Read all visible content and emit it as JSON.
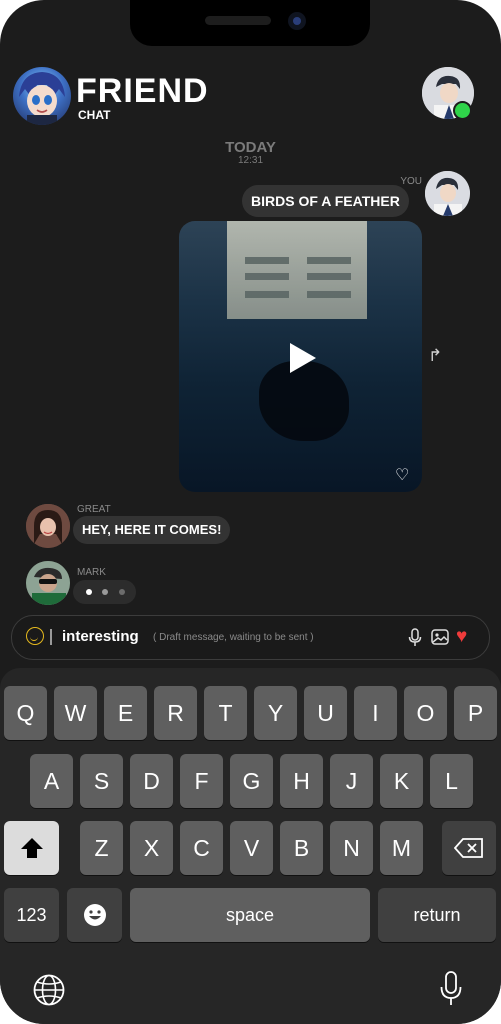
{
  "header": {
    "title": "FRIEND",
    "subtitle": "CHAT",
    "status_color": "#2fd44a"
  },
  "conversation": {
    "date_label": "TODAY",
    "time": "12:31",
    "messages": [
      {
        "sender": "YOU",
        "text": "BIRDS OF A FEATHER",
        "type": "text"
      },
      {
        "sender": "YOU",
        "type": "video",
        "icons": [
          "play-icon",
          "heart-icon",
          "share-icon"
        ]
      },
      {
        "sender": "GREAT",
        "text": "HEY, HERE IT COMES!",
        "type": "text"
      },
      {
        "sender": "MARK",
        "type": "typing",
        "dot_colors": [
          "#ffffff",
          "#9a9a9a",
          "#6c6c6c"
        ]
      }
    ]
  },
  "composer": {
    "draft_text": "interesting",
    "draft_hint": "( Draft message, waiting to be sent )",
    "icons": [
      "emoji-icon",
      "microphone-icon",
      "image-icon",
      "heart-icon"
    ],
    "heart_color": "#ef3b3b",
    "emoji_color": "#e5b91e"
  },
  "keyboard": {
    "row1": [
      "Q",
      "W",
      "E",
      "R",
      "T",
      "Y",
      "U",
      "I",
      "O",
      "P"
    ],
    "row2": [
      "A",
      "S",
      "D",
      "F",
      "G",
      "H",
      "J",
      "K",
      "L"
    ],
    "row3": [
      "Z",
      "X",
      "C",
      "V",
      "B",
      "N",
      "M"
    ],
    "numbers_label": "123",
    "space_label": "space",
    "return_label": "return",
    "icons": [
      "shift-icon",
      "backspace-icon",
      "emoji-key-icon",
      "globe-icon",
      "dictation-mic-icon"
    ]
  }
}
